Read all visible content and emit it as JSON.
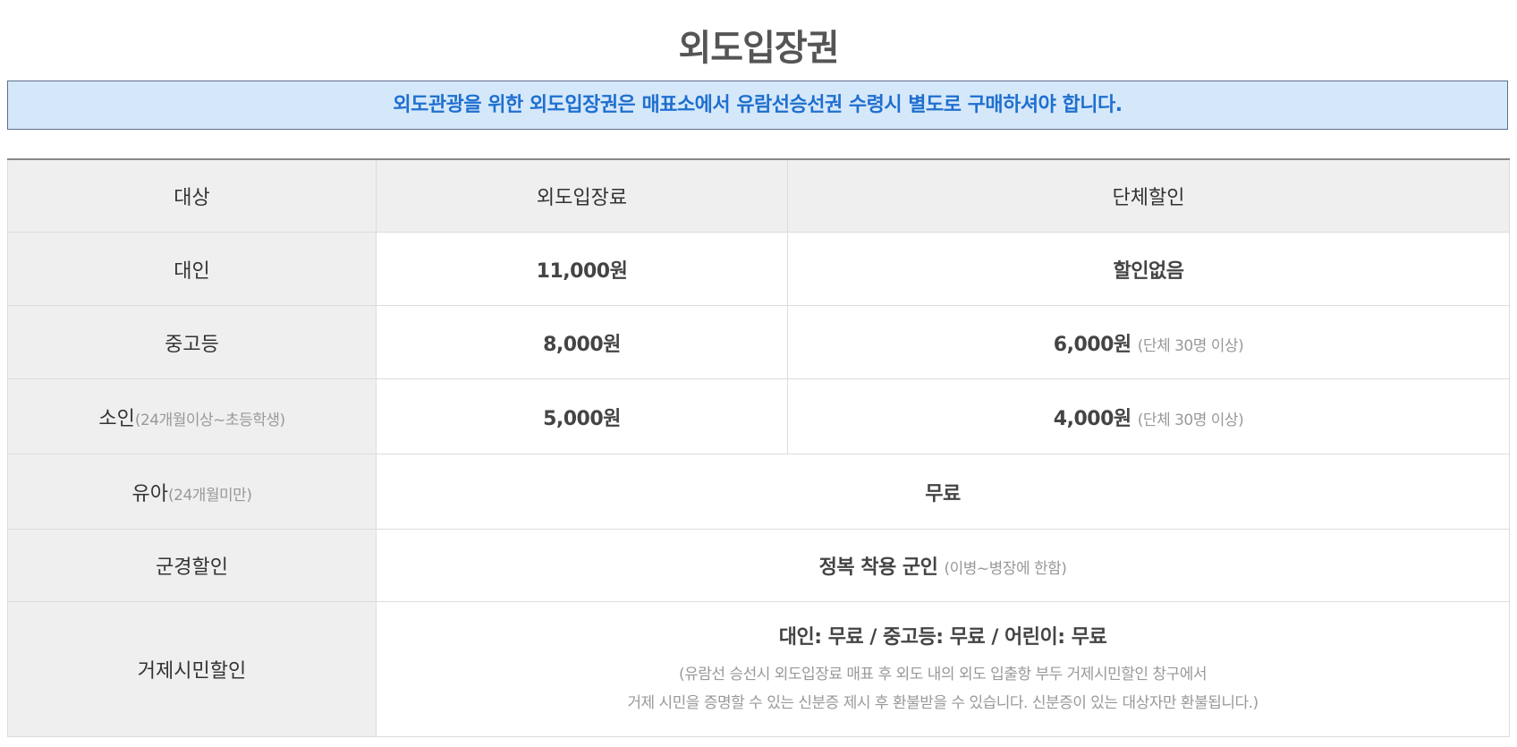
{
  "page": {
    "title": "외도입장권",
    "notice": "외도관광을 위한 외도입장권은 매표소에서 유람선승선권 수령시 별도로 구매하셔야 합니다."
  },
  "table": {
    "headers": [
      "대상",
      "외도입장료",
      "단체할인"
    ],
    "rows": {
      "adult": {
        "label": "대인",
        "fee": "11,000원",
        "group": "할인없음"
      },
      "youth": {
        "label": "중고등",
        "fee": "8,000원",
        "group_price": "6,000원",
        "group_note": "(단체 30명 이상)"
      },
      "child": {
        "label": "소인",
        "label_note": "(24개월이상~초등학생)",
        "fee": "5,000원",
        "group_price": "4,000원",
        "group_note": "(단체 30명 이상)"
      },
      "infant": {
        "label": "유아",
        "label_note": "(24개월미만)",
        "value": "무료"
      },
      "military": {
        "label": "군경할인",
        "value": "정복 착용 군인",
        "value_note": "(이병~병장에 한함)"
      },
      "citizen": {
        "label": "거제시민할인",
        "value": "대인: 무료 / 중고등: 무료 / 어린이: 무료",
        "note_line1": "(유람선 승선시 외도입장료 매표 후 외도 내의 외도 입출항 부두 거제시민할인 창구에서",
        "note_line2": "거제 시민을 증명할 수 있는 신분증 제시 후 환불받을 수 있습니다. 신분증이 있는 대상자만 환불됩니다.)"
      }
    }
  }
}
